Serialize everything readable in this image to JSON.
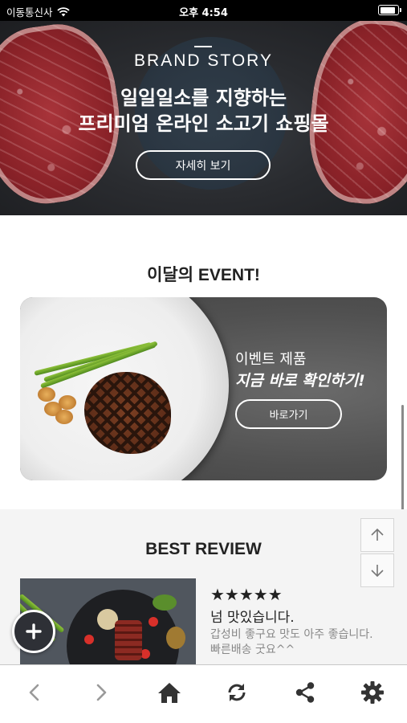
{
  "status_bar": {
    "carrier": "이동통신사",
    "time": "오후 4:54"
  },
  "hero": {
    "brand": "BRAND STORY",
    "headline_line1": "일일일소를 지향하는",
    "headline_line2": "프리미엄 온라인 소고기 쇼핑몰",
    "button_label": "자세히 보기"
  },
  "event": {
    "title": "이달의 EVENT!",
    "subtitle": "이벤트 제품",
    "main_text": "지금 바로 확인하기!",
    "button_label": "바로가기"
  },
  "review": {
    "title": "BEST REVIEW",
    "stars": "★★★★★",
    "rating": 5,
    "headline": "넘 맛있습니다.",
    "body": "갑성비 좋구요 맛도 아주 좋습니다. 빠른배송 굿요^^"
  },
  "icons": {
    "fab": "plus-icon",
    "scroll_up": "arrow-up-icon",
    "scroll_down": "arrow-down-icon",
    "nav": [
      "back-icon",
      "forward-icon",
      "home-icon",
      "refresh-icon",
      "share-icon",
      "settings-icon"
    ]
  },
  "colors": {
    "dark_text": "#222222",
    "muted_text": "#888888",
    "nav_icon": "#333333",
    "nav_icon_disabled": "#9a9a9a",
    "fab_background": "#2e3036"
  }
}
